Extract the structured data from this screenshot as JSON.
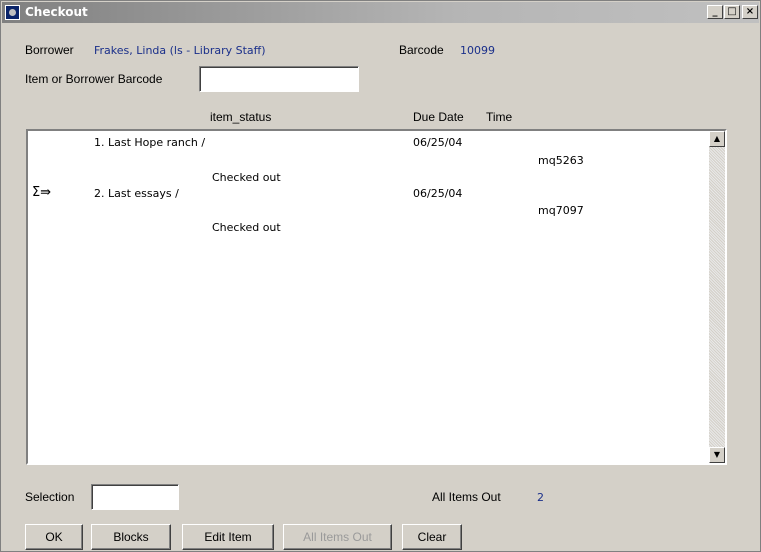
{
  "window": {
    "title": "Checkout"
  },
  "header": {
    "borrower_label": "Borrower",
    "borrower_value": "Frakes, Linda (ls - Library Staff)",
    "barcode_label": "Barcode",
    "barcode_value": "10099",
    "scan_label": "Item or Borrower Barcode",
    "scan_value": ""
  },
  "columns": {
    "status": "item_status",
    "due_date": "Due Date",
    "time": "Time"
  },
  "items": [
    {
      "title": "1. Last Hope ranch /",
      "due": "06/25/04",
      "code": "mq5263",
      "status": "Checked out",
      "selected": false
    },
    {
      "title": "2. Last essays /",
      "due": "06/25/04",
      "code": "mq7097",
      "status": "Checked out",
      "selected": true
    }
  ],
  "selection_arrow": "Σ⇛",
  "footer": {
    "selection_label": "Selection",
    "selection_value": "",
    "all_items_out_label": "All Items Out",
    "all_items_out_count": "2"
  },
  "buttons": {
    "ok": "OK",
    "blocks": "Blocks",
    "edit_item": "Edit Item",
    "all_items_out": "All Items Out",
    "clear": "Clear"
  },
  "titlebar_buttons": {
    "minimize": "_",
    "maximize": "□",
    "close": "×"
  }
}
